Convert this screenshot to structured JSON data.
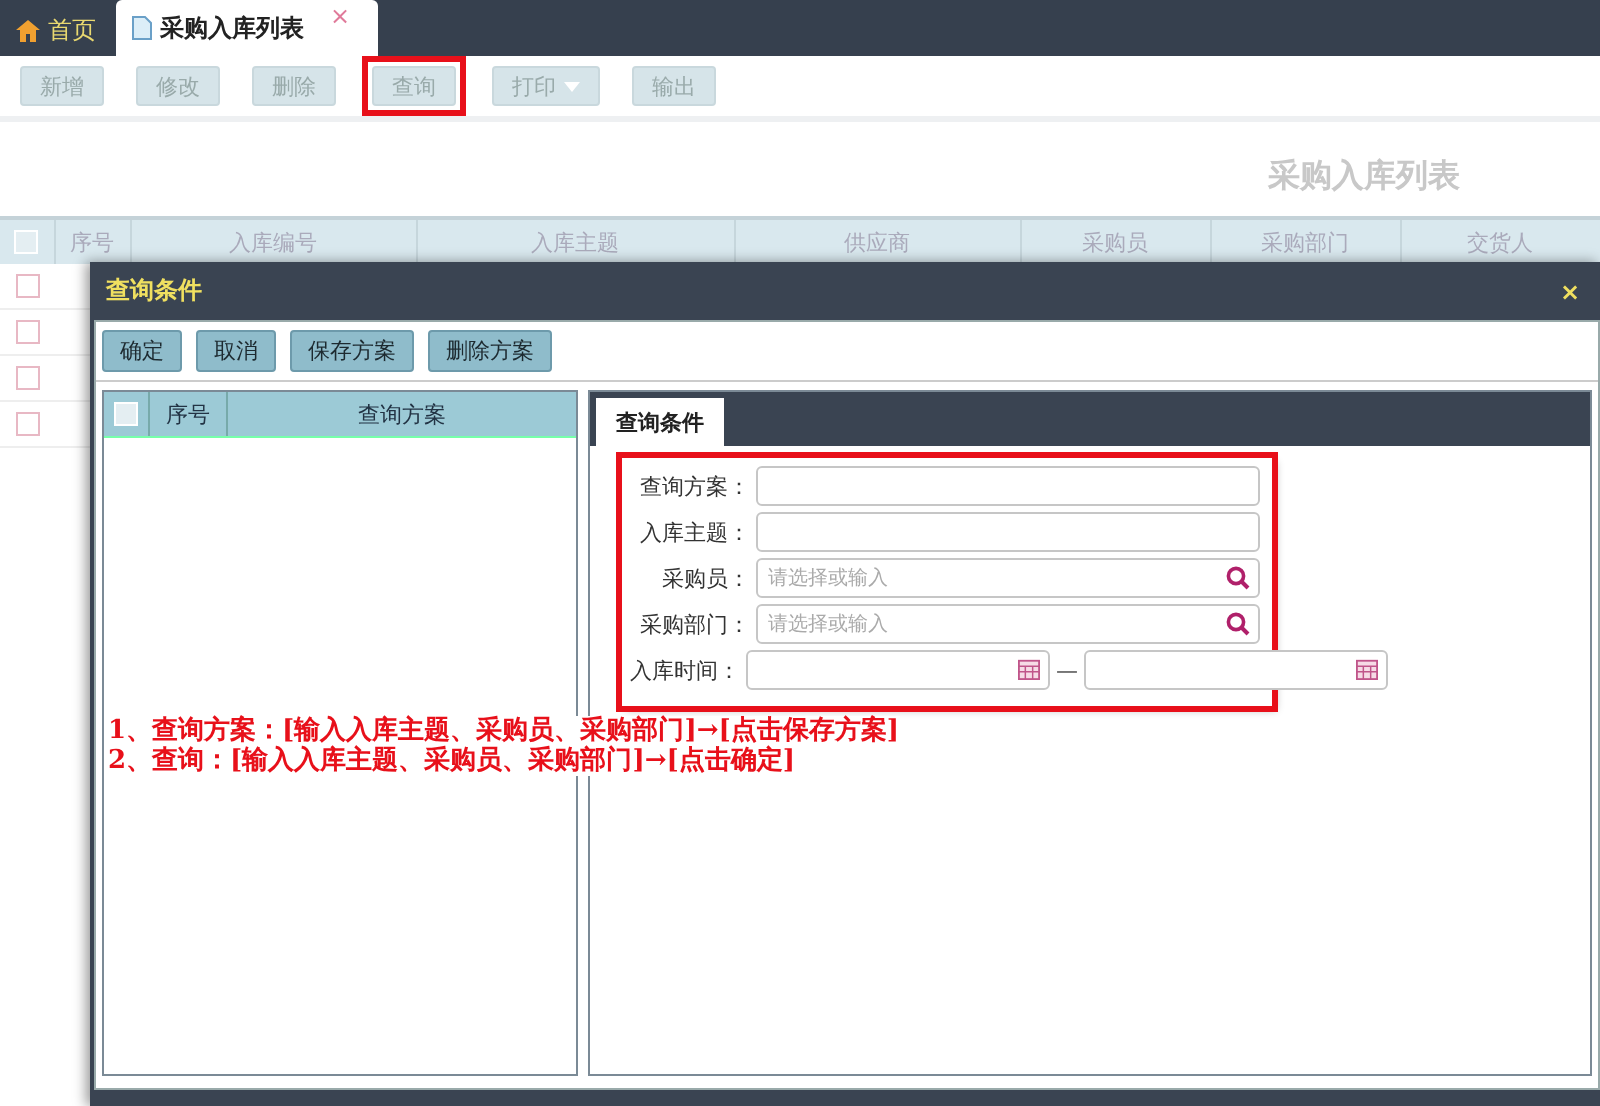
{
  "tabs": [
    {
      "label": "首页",
      "kind": "home",
      "selected": false
    },
    {
      "label": "采购入库列表",
      "kind": "page",
      "selected": true,
      "close": "×"
    }
  ],
  "toolbar": [
    {
      "label": "新增",
      "highlighted": false,
      "kind": "button"
    },
    {
      "label": "修改",
      "highlighted": false,
      "kind": "button"
    },
    {
      "label": "删除",
      "highlighted": false,
      "kind": "button"
    },
    {
      "label": "查询",
      "highlighted": true,
      "kind": "button"
    },
    {
      "label": "打印",
      "highlighted": false,
      "kind": "menu"
    },
    {
      "label": "输出",
      "highlighted": false,
      "kind": "button"
    }
  ],
  "page_title": "采购入库列表",
  "table": {
    "columns": [
      "序号",
      "入库编号",
      "入库主题",
      "供应商",
      "采购员",
      "采购部门",
      "交货人"
    ],
    "header_checked": false,
    "rows": [
      {
        "checked": false
      },
      {
        "checked": false
      },
      {
        "checked": false
      },
      {
        "checked": false
      }
    ]
  },
  "dialog": {
    "title": "查询条件",
    "close": "×",
    "buttons": [
      "确定",
      "取消",
      "保存方案",
      "删除方案"
    ],
    "schemes": {
      "header_checked": false,
      "columns": [
        "序号",
        "查询方案"
      ]
    },
    "tabs": [
      {
        "label": "查询条件",
        "selected": true
      }
    ],
    "form": {
      "highlighted": true,
      "fields": [
        {
          "label": "查询方案：",
          "kind": "text"
        },
        {
          "label": "入库主题：",
          "kind": "text"
        },
        {
          "label": "采购员：",
          "kind": "lookup",
          "placeholder": "请选择或输入"
        },
        {
          "label": "采购部门：",
          "kind": "lookup",
          "placeholder": "请选择或输入"
        },
        {
          "label": "入库时间：",
          "kind": "daterange",
          "separator": "—"
        }
      ]
    },
    "notes": [
      "1、查询方案：[输入入库主题、采购员、采购部门]→[点击保存方案]",
      "2、查询：[输入入库主题、采购员、采购部门]→[点击确定]"
    ]
  }
}
